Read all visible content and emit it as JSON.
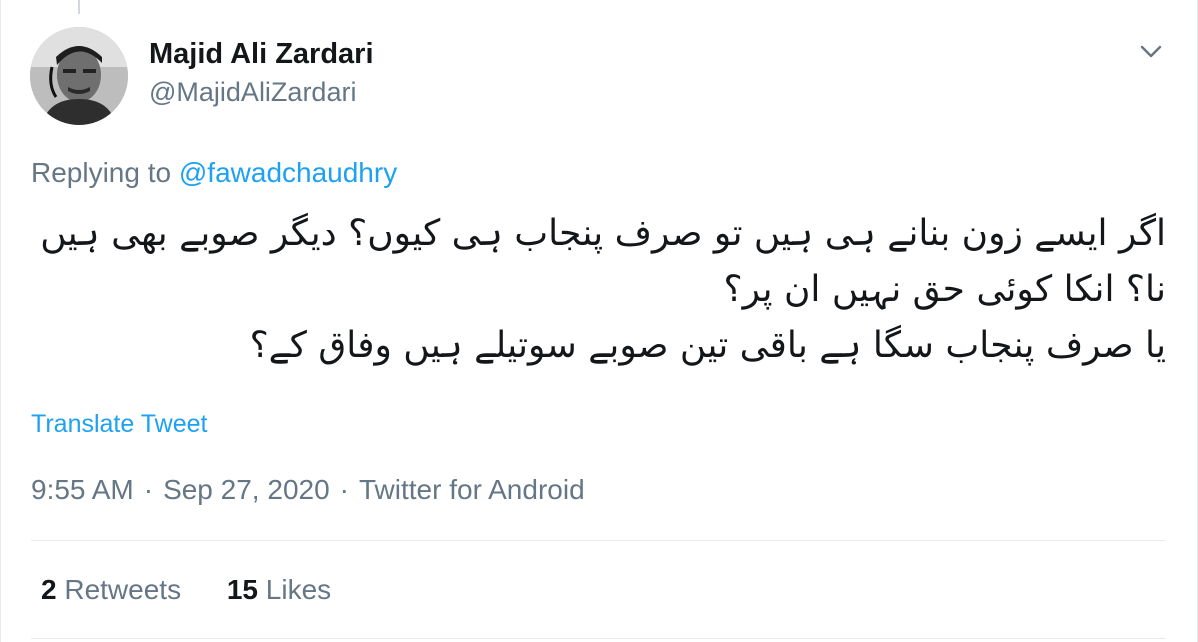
{
  "author": {
    "name": "Majid Ali Zardari",
    "handle": "@MajidAliZardari"
  },
  "reply": {
    "prefix": "Replying to ",
    "to_handle": "@fawadchaudhry"
  },
  "tweet": {
    "text": "اگر ایسے زون بنانے ہی ہیں تو صرف پنجاب ہی کیوں؟ دیگر صوبے بھی ہیں نا؟ انکا کوئی حق نہیں ان پر؟\nیا صرف پنجاب سگا ہے باقی تین صوبے سوتیلے ہیں وفاق کے؟",
    "translate_label": "Translate Tweet"
  },
  "meta": {
    "time": "9:55 AM",
    "date": "Sep 27, 2020",
    "source": "Twitter for Android",
    "separator": "·"
  },
  "stats": {
    "retweets_count": "2",
    "retweets_label": "Retweets",
    "likes_count": "15",
    "likes_label": "Likes"
  },
  "colors": {
    "link": "#1da1f2",
    "secondary_text": "#657786",
    "primary_text": "#14171a"
  },
  "icons": {
    "menu": "chevron-down-icon"
  }
}
